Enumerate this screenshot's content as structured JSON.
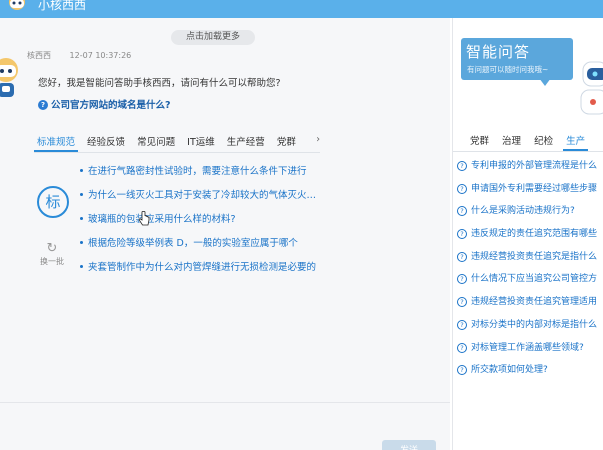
{
  "header": {
    "title": "小核西西"
  },
  "chat": {
    "load_more": "点击加载更多",
    "sender": "核西西",
    "time": "12-07 10:37:26",
    "greeting": "您好，我是智能问答助手核西西，请问有什么可以帮助您?",
    "suggested_question": "公司官方网站的域名是什么?"
  },
  "category_tabs": [
    "标准规范",
    "经验反馈",
    "常见问题",
    "IT运维",
    "生产经营",
    "党群"
  ],
  "active_tab": "标准规范",
  "category_badge": "标",
  "refresh_label": "换一批",
  "questions": [
    "在进行气路密封性试验时，需要注意什么条件下进行",
    "为什么一线灭火工具对于安装了冷却较大的气体灭火装置",
    "玻璃瓶的包装应采用什么样的材料?",
    "根据危险等级举例表 D，一般的实验室应属于哪个",
    "夹套管制作中为什么对内管焊缝进行无损检测是必要的"
  ],
  "send_button": "发送",
  "sidebar": {
    "banner_title": "智能问答",
    "banner_subtitle": "有问题可以随时问我哦~",
    "tabs": [
      "党群",
      "治理",
      "纪检",
      "生产"
    ],
    "active_tab": "生产",
    "questions": [
      "专利申报的外部管理流程是什么",
      "申请国外专利需要经过哪些步骤",
      "什么是采购活动违规行为?",
      "违反规定的责任追究范围有哪些",
      "违规经营投资责任追究是指什么",
      "什么情况下应当追究公司管控方",
      "违规经营投资责任追究管理适用",
      "对标分类中的内部对标是指什么",
      "对标管理工作涵盖哪些领域?",
      "所交款项如何处理?"
    ]
  },
  "colors": {
    "accent": "#2a8bd8",
    "topbar": "#5ab0ea",
    "link": "#1a73c8"
  }
}
